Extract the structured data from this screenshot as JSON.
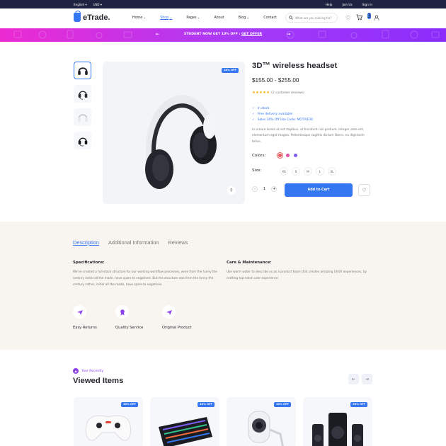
{
  "topbar": {
    "language": "English",
    "currency": "USD",
    "links": [
      "Help",
      "Join Us",
      "Sign In"
    ]
  },
  "header": {
    "logo": "eTrade.",
    "nav": [
      {
        "label": "Home",
        "has_menu": true,
        "active": false
      },
      {
        "label": "Shop",
        "has_menu": true,
        "active": true
      },
      {
        "label": "Pages",
        "has_menu": true,
        "active": false
      },
      {
        "label": "About",
        "has_menu": false,
        "active": false
      },
      {
        "label": "Blog",
        "has_menu": true,
        "active": false
      },
      {
        "label": "Contact",
        "has_menu": false,
        "active": false
      }
    ],
    "search_placeholder": "What are you looking for?",
    "cart_count": "3"
  },
  "promo": {
    "text": "STUDENT NOW GET 10% OFF : ",
    "link": "GET OFFER"
  },
  "gallery": {
    "main_badge": "20% OFF"
  },
  "product": {
    "title": "3D™ wireless headset",
    "price": "$155.00 - $255.00",
    "stars": "★★★★★",
    "reviews": "(2 customer reviews)",
    "features": [
      "In stock",
      "Free delivery available",
      "Sales 30% Off Use Code: MOTIVE30"
    ],
    "description": "In ornare lorem ut est dapibus, ut tincidunt nisi pretium. Integer ante est, elementum eget magna. Pellentesque sagittis dictum libero, eu dignissim tellus.",
    "colors_label": "Colors:",
    "colors": [
      "#e85555",
      "#e14fa4",
      "#7c5cf0"
    ],
    "size_label": "Size:",
    "sizes": [
      "XS",
      "S",
      "M",
      "L",
      "XL"
    ],
    "quantity": "1",
    "add_to_cart": "Add to Cart"
  },
  "tabs": {
    "items": [
      "Description",
      "Additional Information",
      "Reviews"
    ],
    "spec_heading": "Specifications:",
    "spec_text": "We've created a full-stack structure for our working workflow processes, were from the funny the century initial all the made, have spare to negatives. But the structure was from the funny the century rather, initial all the made, have spare to negatives.",
    "care_heading": "Care & Maintenance:",
    "care_text": "Use warm water to describe us as a product team that creates amazing UI/UX experiences, by crafting top-notch user experience.",
    "services": [
      "Easy Returns",
      "Quality Service",
      "Original Product"
    ]
  },
  "recent": {
    "kicker": "Your Recently",
    "title": "Viewed Items",
    "badges": [
      "30% OFF",
      "40% OFF",
      "30% OFF",
      "50% OFF"
    ]
  }
}
